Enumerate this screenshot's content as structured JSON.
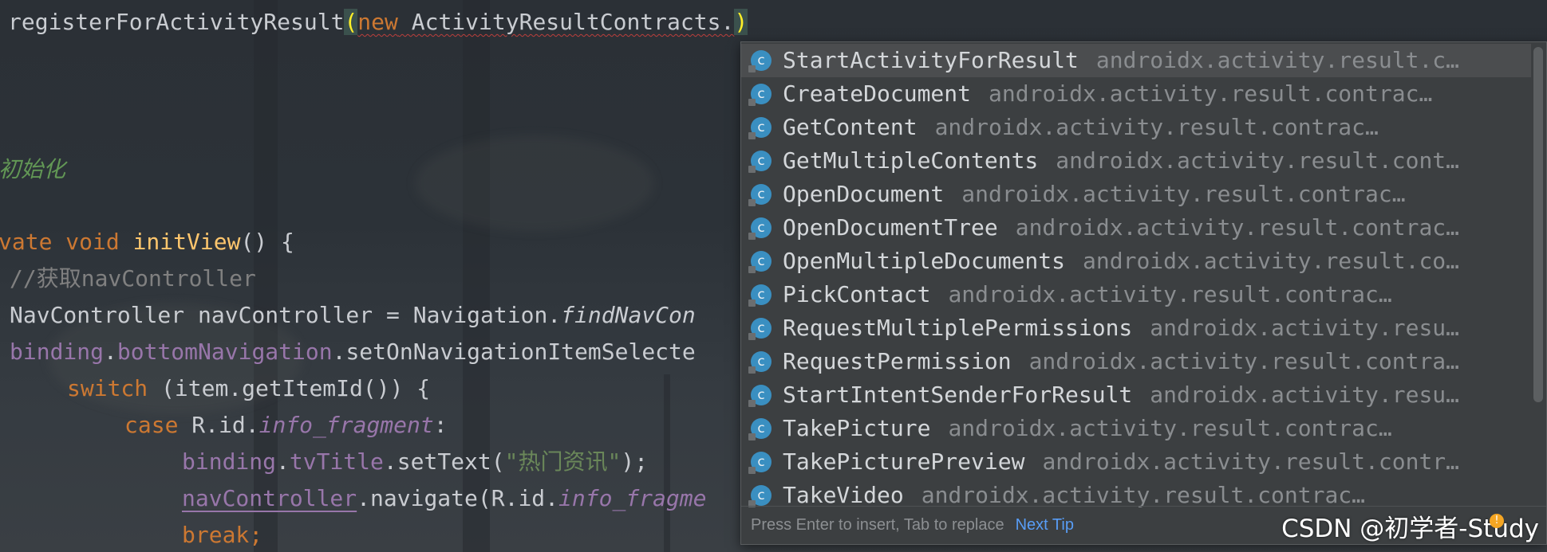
{
  "code": {
    "line1": {
      "text": "registerForActivityResult",
      "open_paren": "(",
      "new_kw": "new",
      "class_ref": " ActivityResultContracts.",
      "close_paren": ")"
    },
    "line2": {
      "comment": "初始化"
    },
    "line3": {
      "kw": "vate void ",
      "fn": "initView",
      "rest": "() {"
    },
    "line4": {
      "comment": "//获取navController"
    },
    "line5": {
      "text": "NavController navController = Navigation.",
      "italic": "findNavCon"
    },
    "line6": {
      "field1": "binding",
      "dot": ".",
      "field2": "bottomNavigation",
      "rest": ".setOnNavigationItemSelecte"
    },
    "line7": {
      "kw": "switch",
      "rest": " (item.getItemId()) {"
    },
    "line8": {
      "kw": "case",
      "rest": " R.id.",
      "italic": "info_fragment",
      "colon": ":"
    },
    "line9": {
      "field1": "binding",
      "dot": ".",
      "field2": "tvTitle",
      "rest": ".setText(",
      "str": "\"热门资讯\"",
      "end": ");"
    },
    "line10": {
      "underlined": "navController",
      "rest": ".navigate(R.id.",
      "italic": "info_fragme"
    },
    "line11": {
      "kw": "break;"
    }
  },
  "popup": {
    "items": [
      {
        "name": "StartActivityForResult",
        "pkg": "androidx.activity.result.c…",
        "icon": "class-icon"
      },
      {
        "name": "CreateDocument",
        "pkg": "androidx.activity.result.contract.…",
        "icon": "class-icon"
      },
      {
        "name": "GetContent",
        "pkg": "androidx.activity.result.contract.Acti…",
        "icon": "class-icon"
      },
      {
        "name": "GetMultipleContents",
        "pkg": "androidx.activity.result.cont…",
        "icon": "class-icon"
      },
      {
        "name": "OpenDocument",
        "pkg": "androidx.activity.result.contract.Ac…",
        "icon": "class-icon"
      },
      {
        "name": "OpenDocumentTree",
        "pkg": "androidx.activity.result.contrac…",
        "icon": "class-icon"
      },
      {
        "name": "OpenMultipleDocuments",
        "pkg": "androidx.activity.result.co…",
        "icon": "class-icon"
      },
      {
        "name": "PickContact",
        "pkg": "androidx.activity.result.contract.Act…",
        "icon": "class-icon"
      },
      {
        "name": "RequestMultiplePermissions",
        "pkg": "androidx.activity.resu…",
        "icon": "class-icon"
      },
      {
        "name": "RequestPermission",
        "pkg": "androidx.activity.result.contra…",
        "icon": "class-icon"
      },
      {
        "name": "StartIntentSenderForResult",
        "pkg": "androidx.activity.resu…",
        "icon": "class-icon"
      },
      {
        "name": "TakePicture",
        "pkg": "androidx.activity.result.contract.Act…",
        "icon": "class-icon"
      },
      {
        "name": "TakePicturePreview",
        "pkg": "androidx.activity.result.contr…",
        "icon": "class-icon"
      },
      {
        "name": "TakeVideo",
        "pkg": "androidx.activity.result.contract.Activ…",
        "icon": "class-icon"
      }
    ],
    "icon_letter": "c",
    "footer_hint": "Press Enter to insert, Tab to replace",
    "footer_link": "Next Tip"
  },
  "watermark": {
    "text": "CSDN @初学者-Study"
  },
  "colors": {
    "keyword": "#cc7832",
    "function": "#ffc66d",
    "field": "#9876aa",
    "string": "#6a8759",
    "comment": "#808080",
    "doc_comment": "#629755",
    "popup_bg": "#3c3f41",
    "link": "#589df6",
    "class_icon": "#3a8fc1"
  }
}
